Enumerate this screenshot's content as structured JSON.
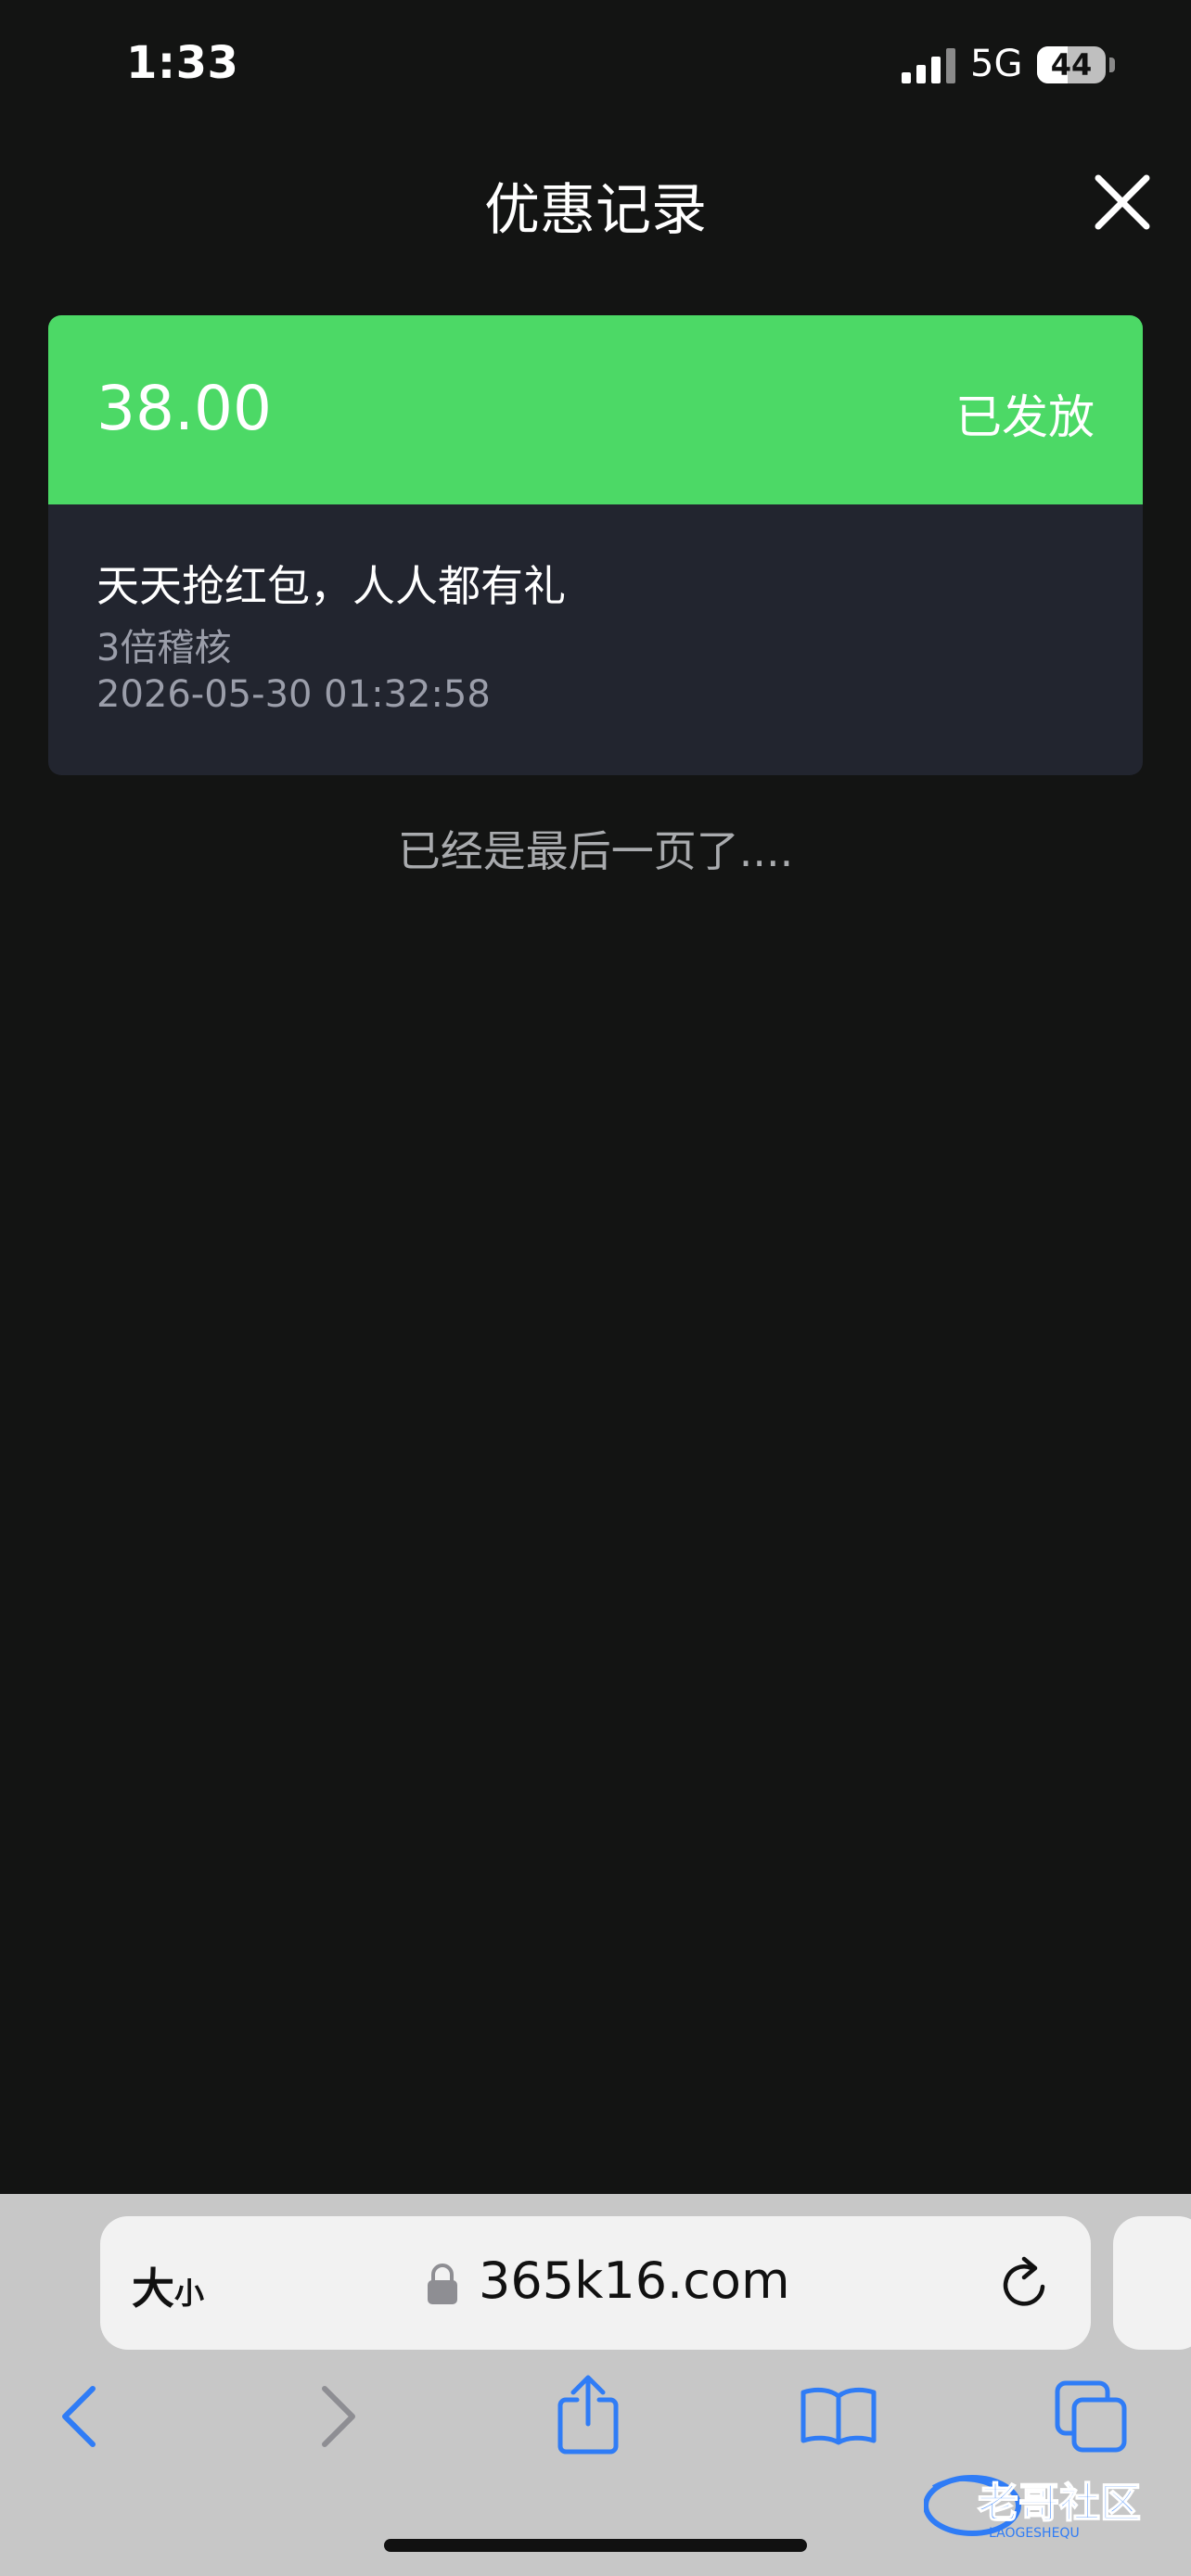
{
  "status_bar": {
    "time": "1:33",
    "network": "5G",
    "battery": "44",
    "battery_level_percent": 44
  },
  "header": {
    "title": "优惠记录",
    "close_icon": "close-icon"
  },
  "record": {
    "amount": "38.00",
    "status": "已发放",
    "title": "天天抢红包，人人都有礼",
    "subtitle": "3倍稽核",
    "timestamp": "2026-05-30 01:32:58"
  },
  "end_message": "已经是最后一页了....",
  "browser": {
    "text_size_label_big": "大",
    "text_size_label_small": "小",
    "url": "365k16.com",
    "icons": {
      "lock": "lock-icon",
      "reload": "reload-icon",
      "back": "back-icon",
      "forward": "forward-icon",
      "share": "share-icon",
      "bookmarks": "bookmarks-icon",
      "tabs": "tabs-icon"
    }
  },
  "watermark": {
    "text": "老哥社区",
    "subtext": "LAOGESHEQU"
  },
  "colors": {
    "background": "#131413",
    "accent_green": "#4cd966",
    "card_body": "#22252f",
    "ios_blue": "#2f7cf6"
  }
}
